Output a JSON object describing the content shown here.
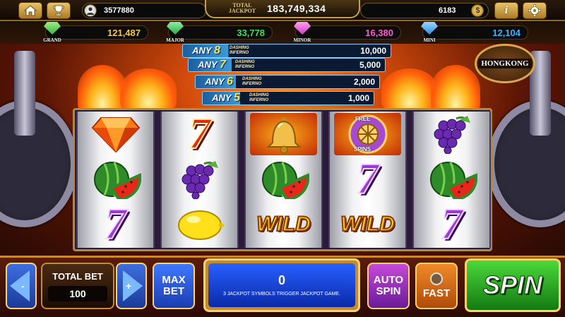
{
  "top": {
    "home_icon": "home-icon",
    "trophy_icon": "trophy-icon",
    "player_icon": "avatar-icon",
    "player_id": "3577880",
    "total_jackpot_label": "TOTAL JACKPOT",
    "total_jackpot_value": "183,749,334",
    "coins_value": "6183",
    "coin_icon": "dollar-coin-icon",
    "info_icon": "info-icon",
    "settings_icon": "gear-icon"
  },
  "jackpots": [
    {
      "name": "GRAND",
      "value": "121,487",
      "color": "#f2c94c",
      "gem_color": "#3ab04a"
    },
    {
      "name": "MAJOR",
      "value": "33,778",
      "color": "#3ee05a",
      "gem_color": "#2fa84a"
    },
    {
      "name": "MINOR",
      "value": "16,380",
      "color": "#ff5ad0",
      "gem_color": "#d23ac8"
    },
    {
      "name": "MINI",
      "value": "12,104",
      "color": "#39b4ff",
      "gem_color": "#2f8ae0"
    }
  ],
  "paytable": [
    {
      "label": "ANY",
      "count": "8",
      "tag": "DASHING INFERNO",
      "value": "10,000"
    },
    {
      "label": "ANY",
      "count": "7",
      "tag": "DASHING INFERNO",
      "value": "5,000"
    },
    {
      "label": "ANY",
      "count": "6",
      "tag": "DASHING INFERNO",
      "value": "2,000"
    },
    {
      "label": "ANY",
      "count": "5",
      "tag": "DASHING INFERNO",
      "value": "1,000"
    }
  ],
  "hk_badge": "HONGKONG",
  "reels": [
    [
      "diamond",
      "watermelon",
      "seven-purple"
    ],
    [
      "seven-red",
      "grapes",
      "lemon"
    ],
    [
      "bell",
      "watermelon",
      "wild"
    ],
    [
      "free-spins-wheel",
      "seven-purple",
      "wild"
    ],
    [
      "grapes",
      "watermelon",
      "seven-purple"
    ]
  ],
  "symbols": {
    "wild_text": "WILD",
    "seven_text": "7",
    "free_spins_top": "FREE",
    "free_spins_bottom": "SPINS"
  },
  "controls": {
    "minus_label": "-",
    "plus_label": "+",
    "total_bet_label": "TOTAL BET",
    "total_bet_value": "100",
    "max_bet_line1": "MAX",
    "max_bet_line2": "BET",
    "win_value": "0",
    "message": "3 JACKPOT SYMBOLS TRIGGER JACKPOT GAME.",
    "auto_spin_line1": "AUTO",
    "auto_spin_line2": "SPIN",
    "fast_label": "FAST",
    "spin_label": "SPIN"
  }
}
